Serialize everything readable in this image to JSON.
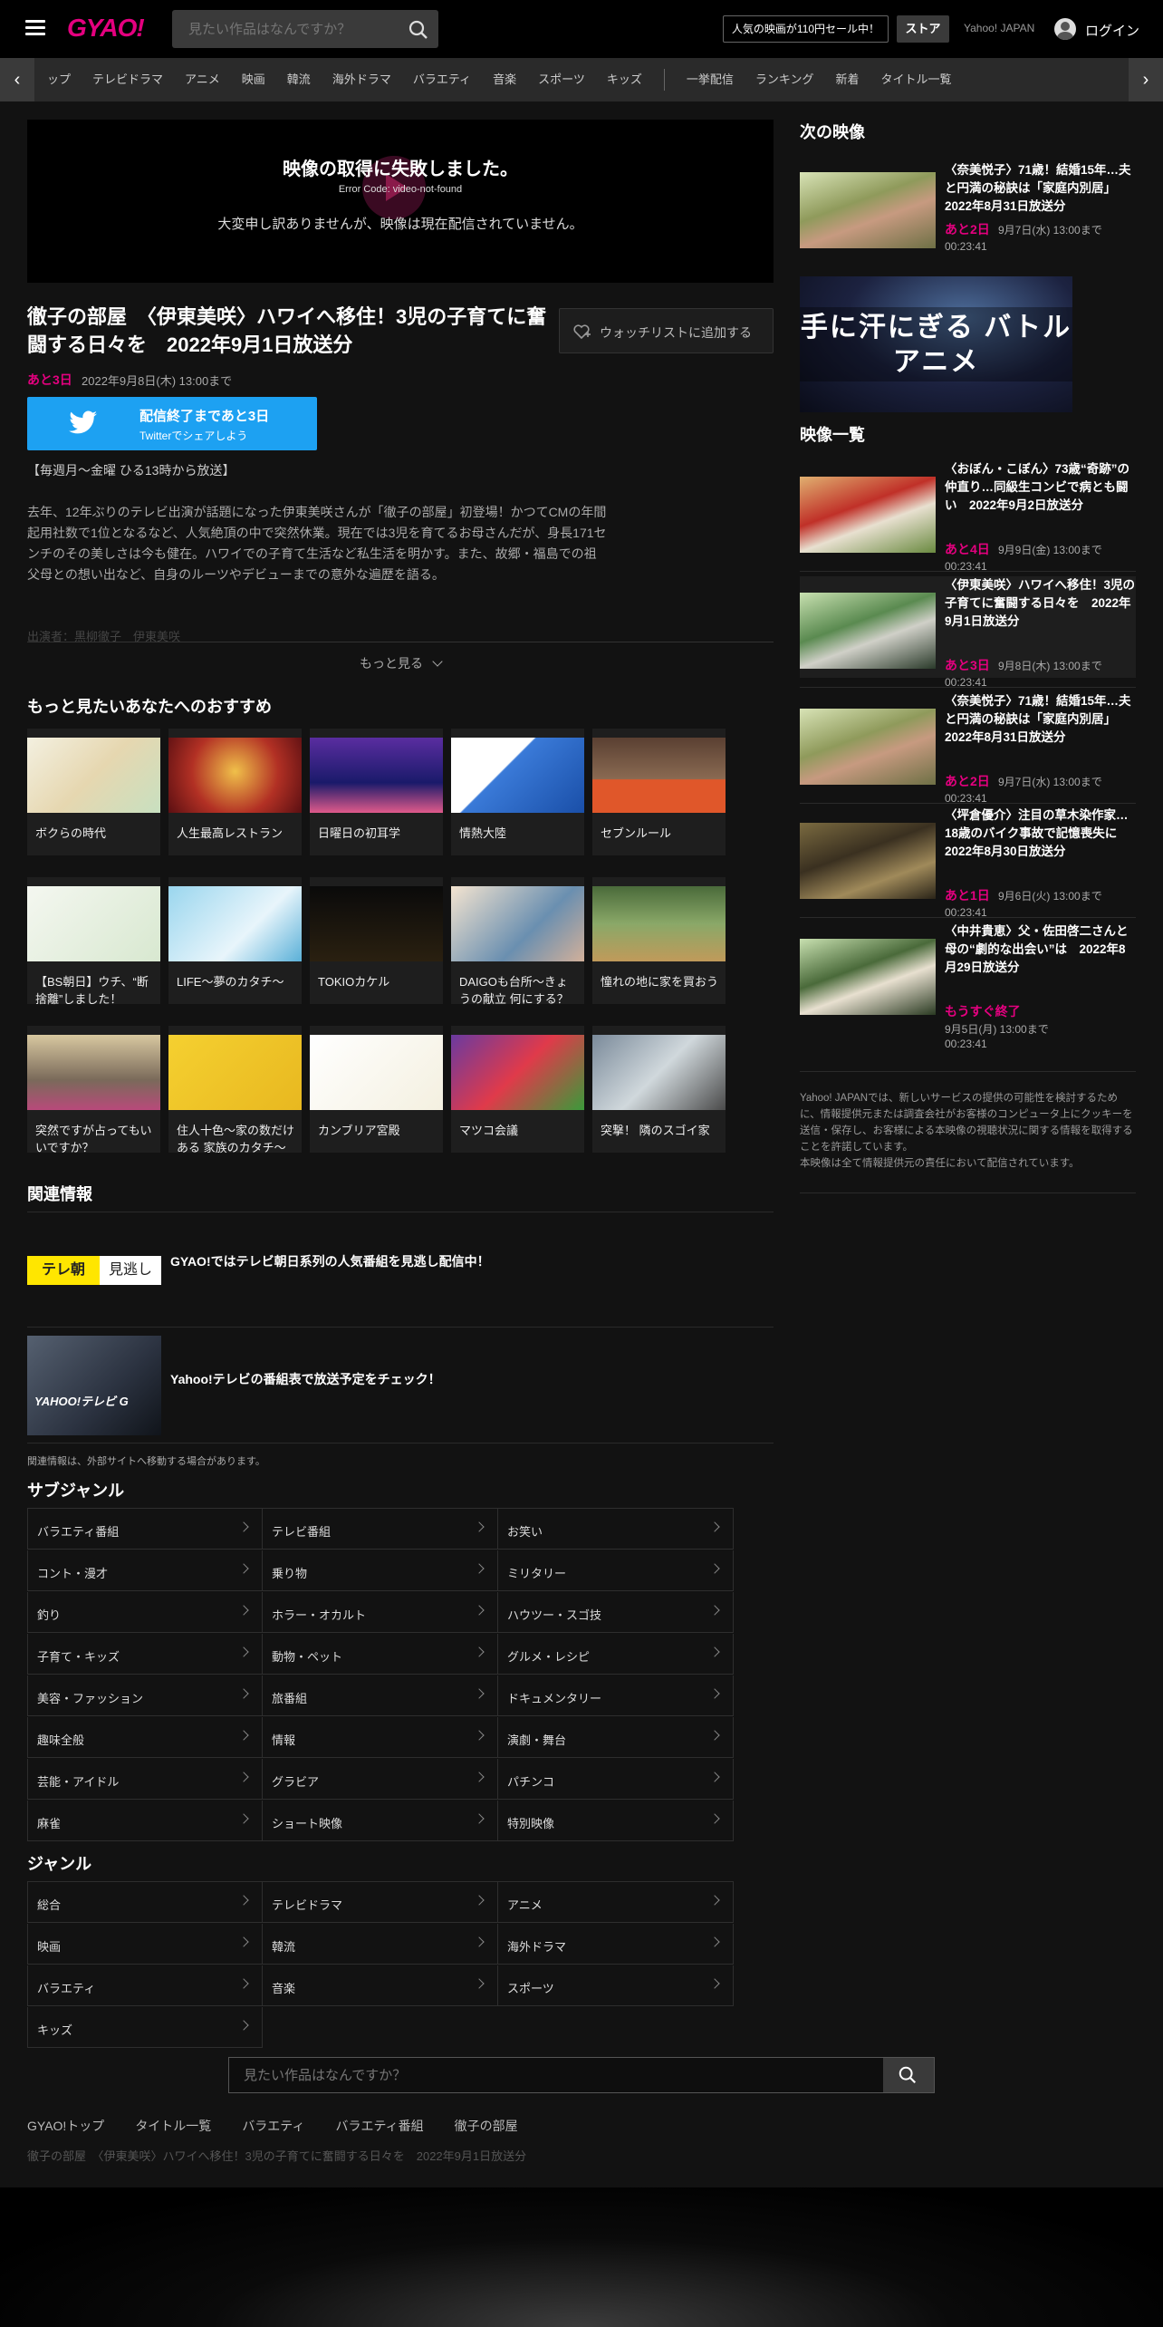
{
  "header": {
    "logo": "GYAO!",
    "search_placeholder": "見たい作品はなんですか？",
    "sale_label": "人気の映画が110円セール中！",
    "store_label": "ストア",
    "yahoo_label": "Yahoo! JAPAN",
    "login_label": "ログイン"
  },
  "nav": {
    "items": [
      "ップ",
      "テレビドラマ",
      "アニメ",
      "映画",
      "韓流",
      "海外ドラマ",
      "バラエティ",
      "音楽",
      "スポーツ",
      "キッズ",
      "一挙配信",
      "ランキング",
      "新着",
      "タイトル一覧"
    ]
  },
  "player": {
    "error_title": "映像の取得に失敗しました。",
    "error_code": "Error Code: video-not-found",
    "error_message": "大変申し訳ありませんが、映像は現在配信されていません。"
  },
  "episode": {
    "title": "徹子の部屋　〈伊東美咲〉ハワイへ移住！3児の子育てに奮闘する日々を　2022年9月1日放送分",
    "watchlist_label": "ウォッチリストに追加する",
    "remaining": "あと3日",
    "available_until": "2022年9月8日(木) 13:00まで",
    "twitter_line1": "配信終了まであと3日",
    "twitter_line2": "Twitterでシェアしよう",
    "schedule": "【毎週月～金曜 ひる13時から放送】",
    "description": "去年、12年ぶりのテレビ出演が話題になった伊東美咲さんが「徹子の部屋」初登場！かつてCMの年間起用社数で1位となるなど、人気絶頂の中で突然休業。現在では3児を育てるお母さんだが、身長171センチのその美しさは今も健在。ハワイでの子育て生活など私生活を明かす。また、故郷・福島での祖父母との想い出など、自身のルーツやデビューまでの意外な遍歴を語る。",
    "cast": "出演者：黒柳徹子　伊東美咲",
    "more_label": "もっと見る"
  },
  "recommend": {
    "heading": "もっと見たいあなたへのおすすめ",
    "items": [
      {
        "title": "ボクらの時代"
      },
      {
        "title": "人生最高レストラン"
      },
      {
        "title": "日曜日の初耳学"
      },
      {
        "title": "情熱大陸"
      },
      {
        "title": "セブンルール"
      },
      {
        "title": "【BS朝日】ウチ、“断捨離”しました！"
      },
      {
        "title": "LIFE～夢のカタチ～"
      },
      {
        "title": "TOKIOカケル"
      },
      {
        "title": "DAIGOも台所～きょうの献立 何にする？"
      },
      {
        "title": "憧れの地に家を買おう"
      },
      {
        "title": "突然ですが占ってもいいですか？"
      },
      {
        "title": "住人十色～家の数だけある 家族のカタチ～"
      },
      {
        "title": "カンブリア宮殿"
      },
      {
        "title": "マツコ会議"
      },
      {
        "title": "突撃！ 隣のスゴイ家"
      }
    ]
  },
  "related": {
    "heading": "関連情報",
    "items": [
      {
        "title": "GYAO!ではテレビ朝日系列の人気番組を見逃し配信中！",
        "banner": "テレ朝 見逃し"
      },
      {
        "title": "Yahoo!テレビの番組表で放送予定をチェック！",
        "banner": "YAHOO! テレビ G GUIDE"
      }
    ],
    "note": "関連情報は、外部サイトへ移動する場合があります。"
  },
  "subgenre": {
    "heading": "サブジャンル",
    "items": [
      "バラエティ番組",
      "テレビ番組",
      "お笑い",
      "コント・漫才",
      "乗り物",
      "ミリタリー",
      "釣り",
      "ホラー・オカルト",
      "ハウツー・スゴ技",
      "子育て・キッズ",
      "動物・ペット",
      "グルメ・レシピ",
      "美容・ファッション",
      "旅番組",
      "ドキュメンタリー",
      "趣味全般",
      "情報",
      "演劇・舞台",
      "芸能・アイドル",
      "グラビア",
      "パチンコ",
      "麻雀",
      "ショート映像",
      "特別映像"
    ]
  },
  "genre": {
    "heading": "ジャンル",
    "items": [
      "総合",
      "テレビドラマ",
      "アニメ",
      "映画",
      "韓流",
      "海外ドラマ",
      "バラエティ",
      "音楽",
      "スポーツ",
      "キッズ"
    ]
  },
  "sidebar": {
    "next_heading": "次の映像",
    "next": {
      "title": "〈奈美悦子〉71歳！結婚15年…夫と円満の秘訣は「家庭内別居」　2022年8月31日放送分",
      "remaining": "あと2日",
      "until": "9月7日(水) 13:00まで",
      "duration": "00:23:41"
    },
    "banner_text": "手に汗にぎる バトルアニメ",
    "list_heading": "映像一覧",
    "list": [
      {
        "title": "〈おぼん・こぼん〉73歳“奇跡”の仲直り…同級生コンビで病とも闘い　2022年9月2日放送分",
        "remaining": "あと4日",
        "until": "9月9日(金) 13:00まで",
        "duration": "00:23:41"
      },
      {
        "title": "〈伊東美咲〉ハワイへ移住！3児の子育てに奮闘する日々を　2022年9月1日放送分",
        "remaining": "あと3日",
        "until": "9月8日(木) 13:00まで",
        "duration": "00:23:41"
      },
      {
        "title": "〈奈美悦子〉71歳！結婚15年…夫と円満の秘訣は「家庭内別居」　2022年8月31日放送分",
        "remaining": "あと2日",
        "until": "9月7日(水) 13:00まで",
        "duration": "00:23:41"
      },
      {
        "title": "〈坪倉優介〉注目の草木染作家…18歳のバイク事故で記憶喪失に　2022年8月30日放送分",
        "remaining": "あと1日",
        "until": "9月6日(火) 13:00まで",
        "duration": "00:23:41"
      },
      {
        "title": "〈中井貴恵〉父・佐田啓二さんと母の“劇的な出会い”は　2022年8月29日放送分",
        "remaining": "もうすぐ終了",
        "until": "9月5日(月) 13:00まで",
        "duration": "00:23:41"
      }
    ],
    "notice": "Yahoo! JAPANでは、新しいサービスの提供の可能性を検討するために、情報提供元または調査会社がお客様のコンピュータ上にクッキーを送信・保存し、お客様による本映像の視聴状況に関する情報を取得することを許諾しています。\n本映像は全て情報提供元の責任において配信されています。"
  },
  "footer": {
    "search_placeholder": "見たい作品はなんですか？",
    "links": [
      "GYAO!トップ",
      "タイトル一覧",
      "バラエティ",
      "バラエティ番組",
      "徹子の部屋"
    ],
    "breadcrumb": "徹子の部屋　〈伊東美咲〉ハワイへ移住！3児の子育てに奮闘する日々を　2022年9月1日放送分"
  },
  "colors": {
    "accent": "#e4007f",
    "twitter": "#1da1f2",
    "background": "#121212"
  }
}
